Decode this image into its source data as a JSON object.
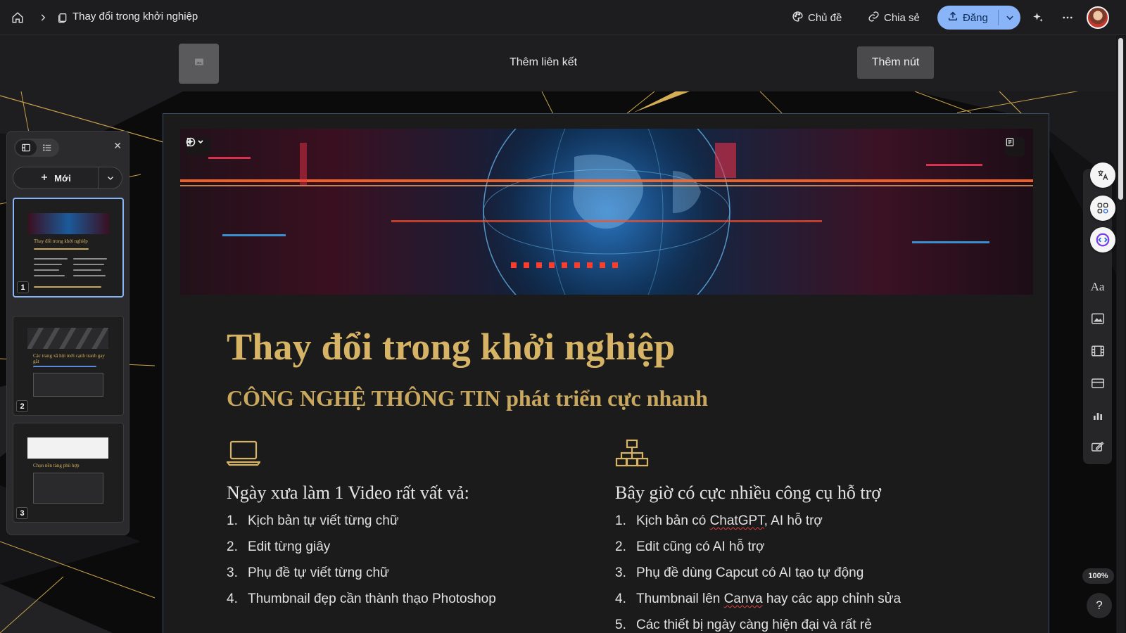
{
  "topbar": {
    "doc_title": "Thay đổi trong khởi nghiệp",
    "theme_label": "Chủ đề",
    "share_label": "Chia sẻ",
    "publish_label": "Đăng"
  },
  "header": {
    "add_link_label": "Thêm liên kết",
    "add_button_label": "Thêm nút"
  },
  "slide": {
    "title": "Thay đổi trong khởi nghiệp",
    "subtitle": "CÔNG NGHỆ THÔNG TIN phát triển cực nhanh",
    "left_column": {
      "heading": "Ngày xưa làm 1 Video rất vất vả:",
      "items": [
        {
          "num": "1.",
          "text": "Kịch bản tự viết từng chữ"
        },
        {
          "num": "2.",
          "text": "Edit từng giây"
        },
        {
          "num": "3.",
          "text": "Phụ đề tự viết từng chữ"
        },
        {
          "num": "4.",
          "text": "Thumbnail đẹp cần thành thạo Photoshop"
        }
      ]
    },
    "right_column": {
      "heading": "Bây giờ có cực nhiều công cụ hỗ trợ",
      "items": [
        {
          "num": "1.",
          "pre": "Kịch bản có ",
          "mark": "ChatGPT",
          "post": ", AI hỗ trợ"
        },
        {
          "num": "2.",
          "pre": "Edit cũng có AI hỗ trợ",
          "mark": "",
          "post": ""
        },
        {
          "num": "3.",
          "pre": "Phụ đề dùng Capcut có AI tạo tự động",
          "mark": "",
          "post": ""
        },
        {
          "num": "4.",
          "pre": "Thumbnail lên ",
          "mark": "Canva",
          "post": " hay các app chỉnh sửa"
        },
        {
          "num": "5.",
          "pre": "Các thiết bị ngày càng hiện đại và rất rẻ",
          "mark": "",
          "post": ""
        }
      ]
    }
  },
  "panel": {
    "new_label": "Mới",
    "thumbnails": [
      {
        "badge": "1",
        "title": "Thay đổi trong khởi nghiệp"
      },
      {
        "badge": "2",
        "title": "Các trang xã hội mới cạnh tranh gay gắt"
      },
      {
        "badge": "3",
        "title": "Chọn nền tảng phù hợp"
      }
    ]
  },
  "zoom_label": "100%",
  "help_label": "?",
  "colors": {
    "accent": "#8ab4f8",
    "gold": "#d7b465",
    "card_bg": "#1b1b1c",
    "topbar_bg": "#1d1d1f"
  },
  "icons": {
    "home": "home-icon",
    "breadcrumb": "chevron-right-icon",
    "document": "document-icon",
    "theme": "palette-icon",
    "share": "link-icon",
    "publish": "upload-icon",
    "spark": "sparkle-icon",
    "more": "more-horizontal-icon",
    "laptop": "laptop-icon",
    "network": "network-icon"
  }
}
